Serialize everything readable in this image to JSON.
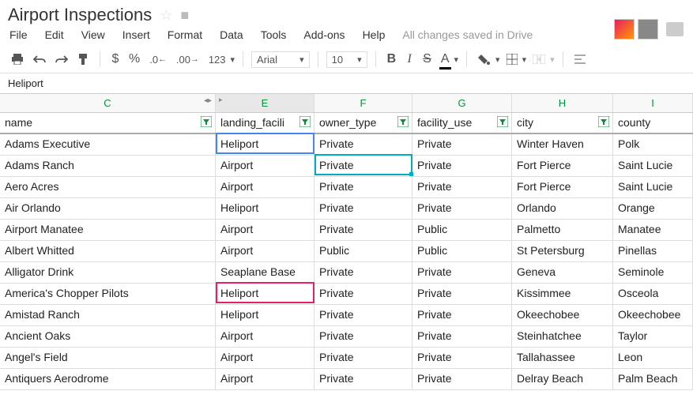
{
  "doc": {
    "title": "Airport Inspections",
    "save_status": "All changes saved in Drive"
  },
  "menu": {
    "file": "File",
    "edit": "Edit",
    "view": "View",
    "insert": "Insert",
    "format": "Format",
    "data": "Data",
    "tools": "Tools",
    "addons": "Add-ons",
    "help": "Help"
  },
  "toolbar": {
    "currency": "$",
    "percent": "%",
    "dec_dec": ".0",
    "dec_inc": ".00",
    "num_format": "123",
    "font": "Arial",
    "size": "10",
    "bold": "B",
    "italic": "I",
    "strike": "S",
    "textA": "A"
  },
  "formula": {
    "value": "Heliport"
  },
  "columns": {
    "c": "C",
    "e": "E",
    "f": "F",
    "g": "G",
    "h": "H",
    "i": "I"
  },
  "headers": {
    "name": "name",
    "landing": "landing_facili",
    "owner": "owner_type",
    "facility": "facility_use",
    "city": "city",
    "county": "county"
  },
  "rows": [
    {
      "name": "Adams Executive",
      "landing": "Heliport",
      "owner": "Private",
      "facility": "Private",
      "city": "Winter Haven",
      "county": "Polk"
    },
    {
      "name": "Adams Ranch",
      "landing": "Airport",
      "owner": "Private",
      "facility": "Private",
      "city": "Fort Pierce",
      "county": "Saint Lucie"
    },
    {
      "name": "Aero Acres",
      "landing": "Airport",
      "owner": "Private",
      "facility": "Private",
      "city": "Fort Pierce",
      "county": "Saint Lucie"
    },
    {
      "name": "Air Orlando",
      "landing": "Heliport",
      "owner": "Private",
      "facility": "Private",
      "city": "Orlando",
      "county": "Orange"
    },
    {
      "name": "Airport Manatee",
      "landing": "Airport",
      "owner": "Private",
      "facility": "Public",
      "city": "Palmetto",
      "county": "Manatee"
    },
    {
      "name": "Albert Whitted",
      "landing": "Airport",
      "owner": "Public",
      "facility": "Public",
      "city": "St Petersburg",
      "county": "Pinellas"
    },
    {
      "name": "Alligator Drink",
      "landing": "Seaplane Base",
      "owner": "Private",
      "facility": "Private",
      "city": "Geneva",
      "county": "Seminole"
    },
    {
      "name": "America's Chopper Pilots",
      "landing": "Heliport",
      "owner": "Private",
      "facility": "Private",
      "city": "Kissimmee",
      "county": "Osceola"
    },
    {
      "name": "Amistad Ranch",
      "landing": "Heliport",
      "owner": "Private",
      "facility": "Private",
      "city": "Okeechobee",
      "county": "Okeechobee"
    },
    {
      "name": "Ancient Oaks",
      "landing": "Airport",
      "owner": "Private",
      "facility": "Private",
      "city": "Steinhatchee",
      "county": "Taylor"
    },
    {
      "name": "Angel's Field",
      "landing": "Airport",
      "owner": "Private",
      "facility": "Private",
      "city": "Tallahassee",
      "county": "Leon"
    },
    {
      "name": "Antiquers Aerodrome",
      "landing": "Airport",
      "owner": "Private",
      "facility": "Private",
      "city": "Delray Beach",
      "county": "Palm Beach"
    }
  ]
}
